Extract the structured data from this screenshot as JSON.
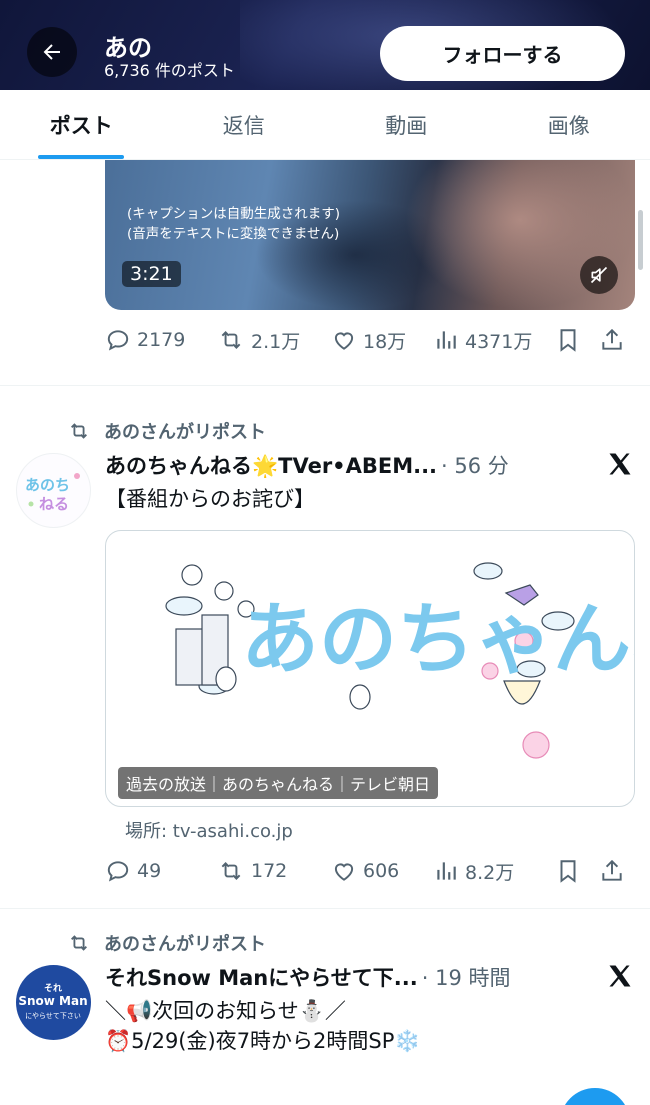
{
  "header": {
    "back_icon": "arrow-left-icon",
    "name": "あの",
    "post_count": "6,736 件のポスト",
    "follow_label": "フォローする"
  },
  "tabs": [
    {
      "label": "ポスト",
      "active": true
    },
    {
      "label": "返信",
      "active": false
    },
    {
      "label": "動画",
      "active": false
    },
    {
      "label": "画像",
      "active": false
    }
  ],
  "video": {
    "caption_line1": "(キャプションは自動生成されます)",
    "caption_line2": "(音声をテキストに変換できません)",
    "duration": "3:21",
    "mute_icon": "speaker-muted-icon"
  },
  "post1_actions": {
    "replies": "2179",
    "reposts": "2.1万",
    "likes": "18万",
    "views": "4371万"
  },
  "post2": {
    "repost_note": "あのさんがリポスト",
    "name": "あのちゃんねる🌟TVer•ABEM...",
    "time": "· 56 分",
    "text": "【番組からのお詫び】",
    "card_title_art": "あのちゃんねる",
    "card_label": "過去の放送｜あのちゃんねる｜テレビ朝日",
    "card_domain": "場所: tv-asahi.co.jp",
    "actions": {
      "replies": "49",
      "reposts": "172",
      "likes": "606",
      "views": "8.2万"
    }
  },
  "post3": {
    "repost_note": "あのさんがリポスト",
    "name": "それSnow Manにやらせて下...",
    "time": "· 19 時間",
    "line1": "＼📢次回のお知らせ⛄／",
    "line2": "⏰5/29(金)夜7時から2時間SP❄️",
    "avatar_line1": "それ",
    "avatar_line2": "Snow Man",
    "avatar_line3": "にやらせて下さい"
  },
  "colors": {
    "accent": "#1d9bf0",
    "secondary_text": "#536471",
    "header_bg": "#10163a"
  }
}
